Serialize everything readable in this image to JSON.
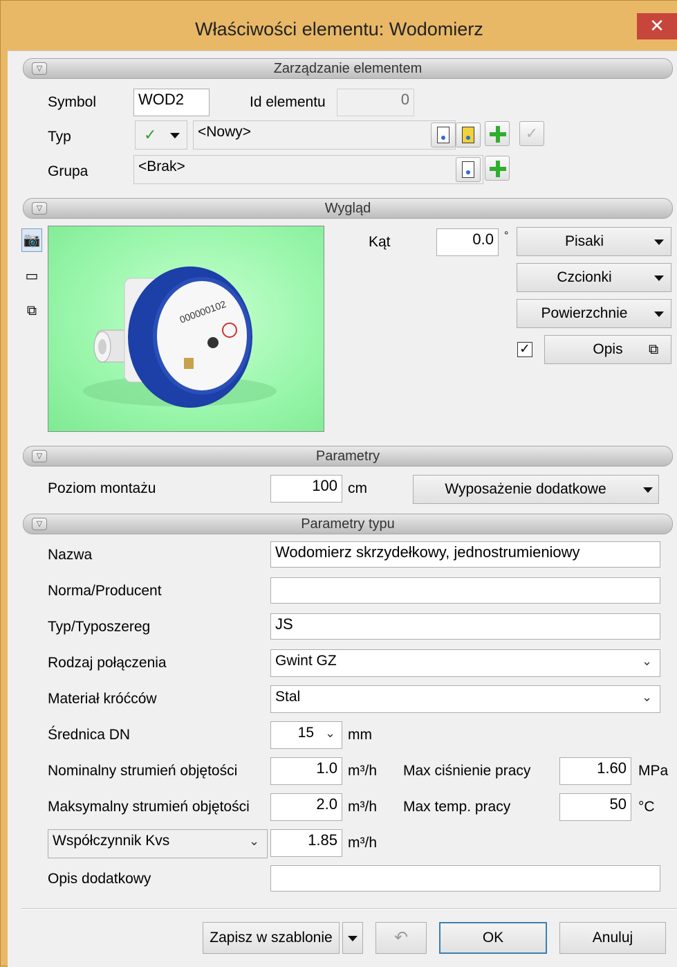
{
  "window": {
    "title": "Właściwości elementu: Wodomierz",
    "close": "✕"
  },
  "sections": {
    "management": "Zarządzanie elementem",
    "appearance": "Wygląd",
    "parameters": "Parametry",
    "type_parameters": "Parametry typu"
  },
  "management": {
    "symbol_label": "Symbol",
    "symbol_value": "WOD2",
    "id_label": "Id elementu",
    "id_value": "0",
    "type_label": "Typ",
    "type_value": "<Nowy>",
    "group_label": "Grupa",
    "group_value": "<Brak>"
  },
  "appearance": {
    "angle_label": "Kąt",
    "angle_value": "0.0",
    "angle_unit": "°",
    "pens_button": "Pisaki",
    "fonts_button": "Czcionki",
    "surfaces_button": "Powierzchnie",
    "description_button": "Opis",
    "description_checked": true
  },
  "parameters": {
    "mount_level_label": "Poziom montażu",
    "mount_level_value": "100",
    "mount_level_unit": "cm",
    "extra_equipment_button": "Wyposażenie dodatkowe"
  },
  "type_parameters": {
    "name_label": "Nazwa",
    "name_value": "Wodomierz skrzydełkowy, jednostrumieniowy",
    "norm_label": "Norma/Producent",
    "norm_value": "",
    "type_series_label": "Typ/Typoszereg",
    "type_series_value": "JS",
    "connection_label": "Rodzaj połączenia",
    "connection_value": "Gwint GZ",
    "stub_material_label": "Materiał króćców",
    "stub_material_value": "Stal",
    "diameter_label": "Średnica DN",
    "diameter_value": "15",
    "diameter_unit": "mm",
    "nominal_flow_label": "Nominalny strumień objętości",
    "nominal_flow_value": "1.0",
    "flow_unit": "m³/h",
    "max_pressure_label": "Max ciśnienie pracy",
    "max_pressure_value": "1.60",
    "pressure_unit": "MPa",
    "max_flow_label": "Maksymalny strumień objętości",
    "max_flow_value": "2.0",
    "max_temp_label": "Max temp. pracy",
    "max_temp_value": "50",
    "temp_unit": "°C",
    "kvs_select": "Współczynnik Kvs",
    "kvs_value": "1.85",
    "extra_description_label": "Opis dodatkowy",
    "extra_description_value": ""
  },
  "footer": {
    "save_template": "Zapisz w szablonie",
    "ok": "OK",
    "cancel": "Anuluj"
  },
  "colors": {
    "frame": "#e8b866",
    "close_button": "#c7463b",
    "preview_background": "#9cf7ad",
    "meter_blue": "#1c3fa8",
    "add_green": "#2fae2f"
  }
}
